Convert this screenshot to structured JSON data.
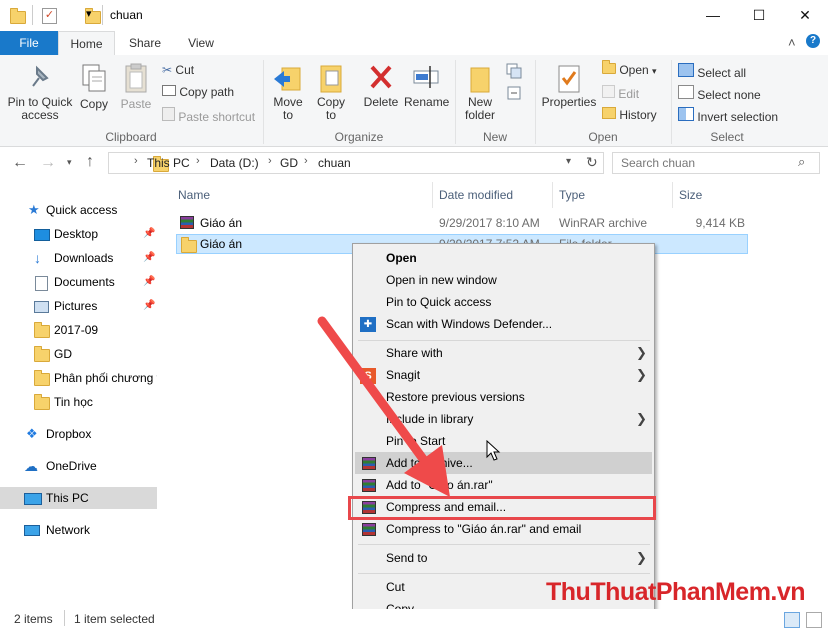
{
  "window": {
    "title": "chuan",
    "minimize_glyph": "—",
    "maximize_glyph": "☐",
    "close_glyph": "✕",
    "help_glyph": "?",
    "collapse_glyph": "˄",
    "qat_dropdown_glyph": "▾"
  },
  "ribbon_tabs": [
    "File",
    "Home",
    "Share",
    "View"
  ],
  "ribbon": {
    "clipboard": {
      "label": "Clipboard",
      "pin_to_quick_access": "Pin to Quick access",
      "copy": "Copy",
      "paste": "Paste",
      "cut": "Cut",
      "copy_path": "Copy path",
      "paste_shortcut": "Paste shortcut"
    },
    "organize": {
      "label": "Organize",
      "move_to": "Move to",
      "copy_to": "Copy to",
      "delete": "Delete",
      "rename": "Rename"
    },
    "new": {
      "label": "New",
      "new_folder": "New folder"
    },
    "open": {
      "label": "Open",
      "properties": "Properties",
      "open": "Open",
      "edit": "Edit",
      "history": "History"
    },
    "select": {
      "label": "Select",
      "select_all": "Select all",
      "select_none": "Select none",
      "invert_selection": "Invert selection"
    }
  },
  "address": {
    "breadcrumbs": [
      "This PC",
      "Data (D:)",
      "GD",
      "chuan"
    ],
    "search_placeholder": "Search chuan"
  },
  "nav_pane": {
    "items": [
      {
        "label": "Quick access",
        "icon": "star-icon",
        "pinned": false
      },
      {
        "label": "Desktop",
        "icon": "desktop-icon",
        "pinned": true
      },
      {
        "label": "Downloads",
        "icon": "download-icon",
        "pinned": true
      },
      {
        "label": "Documents",
        "icon": "documents-icon",
        "pinned": true
      },
      {
        "label": "Pictures",
        "icon": "pictures-icon",
        "pinned": true
      },
      {
        "label": "2017-09",
        "icon": "folder-icon",
        "pinned": false
      },
      {
        "label": "GD",
        "icon": "folder-icon",
        "pinned": false
      },
      {
        "label": "Phân phối chương t",
        "icon": "folder-icon",
        "pinned": false
      },
      {
        "label": "Tin học",
        "icon": "folder-icon",
        "pinned": false
      },
      {
        "label": "Dropbox",
        "icon": "dropbox-icon",
        "pinned": false
      },
      {
        "label": "OneDrive",
        "icon": "cloud-icon",
        "pinned": false
      },
      {
        "label": "This PC",
        "icon": "computer-icon",
        "pinned": false
      },
      {
        "label": "Network",
        "icon": "network-icon",
        "pinned": false
      }
    ]
  },
  "file_list": {
    "columns": [
      "Name",
      "Date modified",
      "Type",
      "Size"
    ],
    "rows": [
      {
        "name": "Giáo án",
        "date": "9/29/2017 8:10 AM",
        "type": "WinRAR archive",
        "size": "9,414 KB",
        "icon": "winrar-icon"
      },
      {
        "name": "Giáo án",
        "date": "9/29/2017 7:52 AM",
        "type": "File folder",
        "size": "",
        "icon": "folder-icon"
      }
    ]
  },
  "context_menu": {
    "items": [
      "Open",
      "Open in new window",
      "Pin to Quick access",
      "Scan with Windows Defender...",
      "Share with",
      "Snagit",
      "Restore previous versions",
      "Include in library",
      "Pin to Start",
      "Add to archive...",
      "Add to \"Giáo án.rar\"",
      "Compress and email...",
      "Compress to \"Giáo án.rar\" and email",
      "Send to",
      "Cut",
      "Copy"
    ],
    "submenu_glyph": "❯"
  },
  "status": {
    "items_count": "2 items",
    "selected": "1 item selected"
  },
  "watermark": "ThuThuatPhanMem.vn",
  "colors": {
    "file_tab": "#1979ca",
    "selection": "#cce8ff",
    "highlight_box": "#e8474b",
    "arrow": "#ef4a4a"
  }
}
